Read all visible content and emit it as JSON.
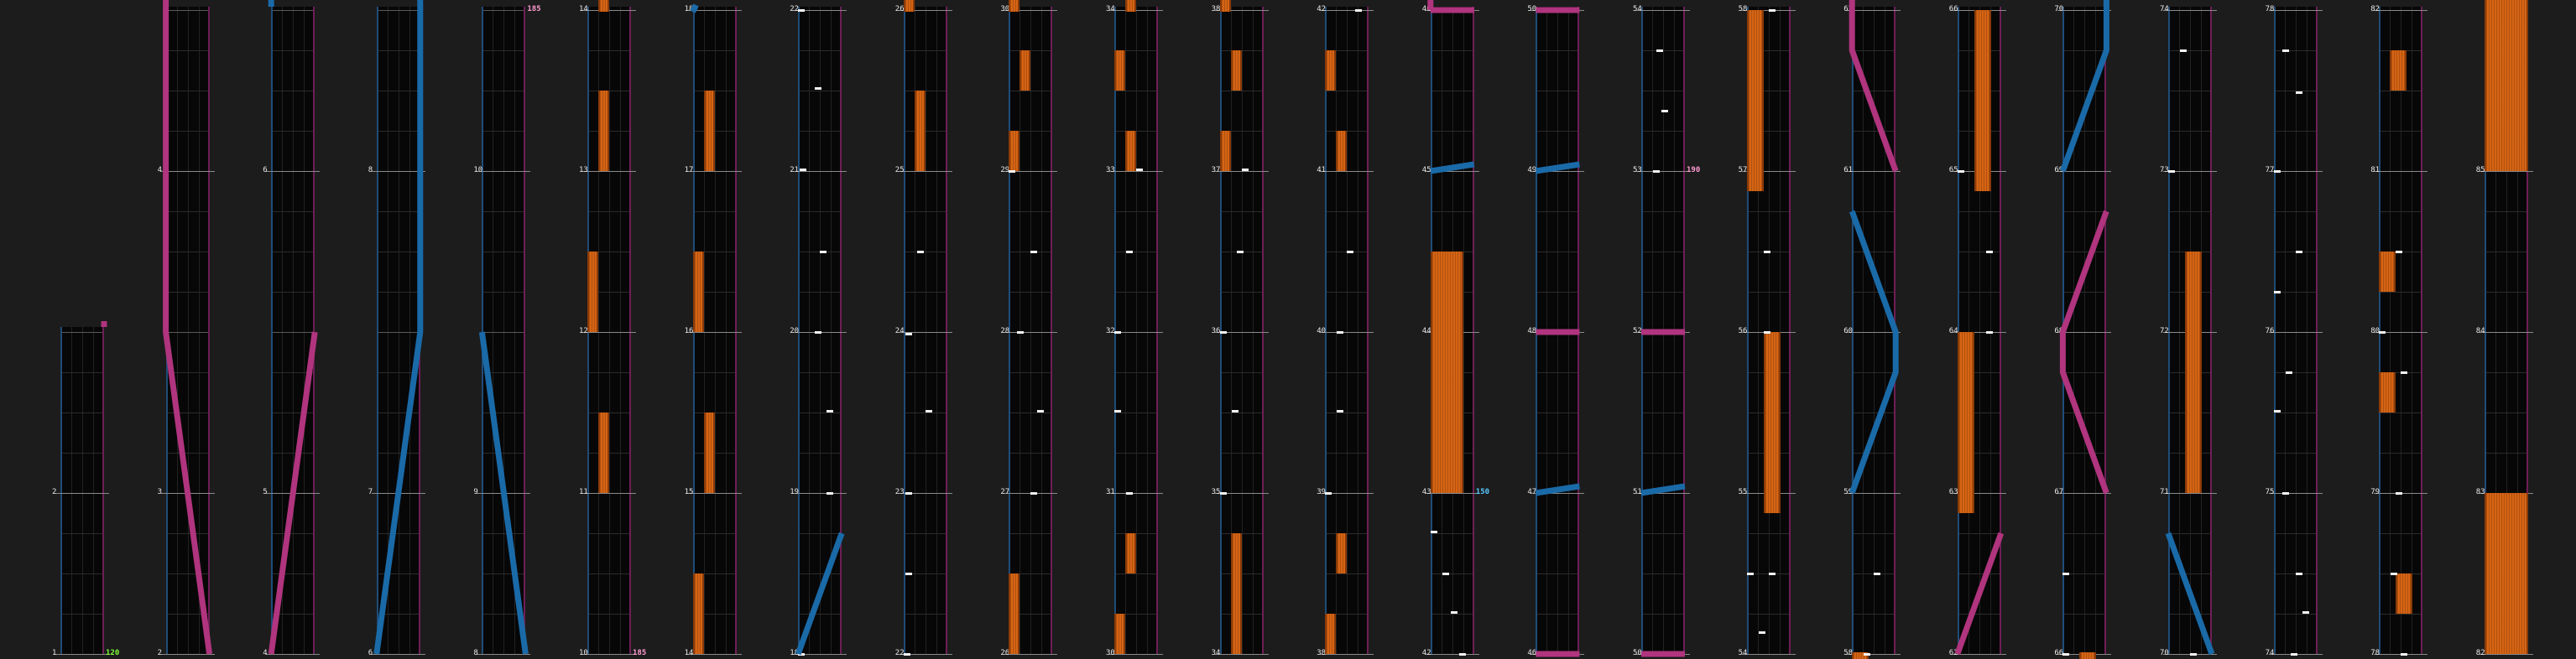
{
  "colors": {
    "background": "#1c1c1c",
    "lane": "#070707",
    "left_slide": "#1a6aa8",
    "right_slide": "#b0347e",
    "hold": "#d66414",
    "tap": "#f3f3f3",
    "bpm_green": "#7fff3a",
    "bpm_pink": "#ff9bd2",
    "bpm_blue": "#58c8ff"
  },
  "measures": [
    {
      "n": "1",
      "c": 0,
      "r": 0
    },
    {
      "n": "2",
      "c": 0,
      "r": 1
    },
    {
      "n": "2",
      "c": 1,
      "r": 0
    },
    {
      "n": "3",
      "c": 1,
      "r": 1
    },
    {
      "n": "4",
      "c": 1,
      "r": 3
    },
    {
      "n": "4",
      "c": 2,
      "r": 0
    },
    {
      "n": "5",
      "c": 2,
      "r": 1
    },
    {
      "n": "6",
      "c": 2,
      "r": 3
    },
    {
      "n": "6",
      "c": 3,
      "r": 0
    },
    {
      "n": "7",
      "c": 3,
      "r": 1
    },
    {
      "n": "8",
      "c": 3,
      "r": 3
    },
    {
      "n": "8",
      "c": 4,
      "r": 0
    },
    {
      "n": "9",
      "c": 4,
      "r": 1
    },
    {
      "n": "10",
      "c": 4,
      "r": 3
    },
    {
      "n": "10",
      "c": 5,
      "r": 0
    },
    {
      "n": "11",
      "c": 5,
      "r": 1
    },
    {
      "n": "12",
      "c": 5,
      "r": 2
    },
    {
      "n": "13",
      "c": 5,
      "r": 3
    },
    {
      "n": "14",
      "c": 5,
      "r": 4
    },
    {
      "n": "14",
      "c": 6,
      "r": 0
    },
    {
      "n": "15",
      "c": 6,
      "r": 1
    },
    {
      "n": "16",
      "c": 6,
      "r": 2
    },
    {
      "n": "17",
      "c": 6,
      "r": 3
    },
    {
      "n": "18",
      "c": 6,
      "r": 4
    },
    {
      "n": "18",
      "c": 7,
      "r": 0
    },
    {
      "n": "19",
      "c": 7,
      "r": 1
    },
    {
      "n": "20",
      "c": 7,
      "r": 2
    },
    {
      "n": "21",
      "c": 7,
      "r": 3
    },
    {
      "n": "22",
      "c": 7,
      "r": 4
    },
    {
      "n": "22",
      "c": 8,
      "r": 0
    },
    {
      "n": "23",
      "c": 8,
      "r": 1
    },
    {
      "n": "24",
      "c": 8,
      "r": 2
    },
    {
      "n": "25",
      "c": 8,
      "r": 3
    },
    {
      "n": "26",
      "c": 8,
      "r": 4
    },
    {
      "n": "26",
      "c": 9,
      "r": 0
    },
    {
      "n": "27",
      "c": 9,
      "r": 1
    },
    {
      "n": "28",
      "c": 9,
      "r": 2
    },
    {
      "n": "29",
      "c": 9,
      "r": 3
    },
    {
      "n": "30",
      "c": 9,
      "r": 4
    },
    {
      "n": "30",
      "c": 10,
      "r": 0
    },
    {
      "n": "31",
      "c": 10,
      "r": 1
    },
    {
      "n": "32",
      "c": 10,
      "r": 2
    },
    {
      "n": "33",
      "c": 10,
      "r": 3
    },
    {
      "n": "34",
      "c": 10,
      "r": 4
    },
    {
      "n": "34",
      "c": 11,
      "r": 0
    },
    {
      "n": "35",
      "c": 11,
      "r": 1
    },
    {
      "n": "36",
      "c": 11,
      "r": 2
    },
    {
      "n": "37",
      "c": 11,
      "r": 3
    },
    {
      "n": "38",
      "c": 11,
      "r": 4
    },
    {
      "n": "38",
      "c": 12,
      "r": 0
    },
    {
      "n": "39",
      "c": 12,
      "r": 1
    },
    {
      "n": "40",
      "c": 12,
      "r": 2
    },
    {
      "n": "41",
      "c": 12,
      "r": 3
    },
    {
      "n": "42",
      "c": 12,
      "r": 4
    },
    {
      "n": "42",
      "c": 13,
      "r": 0
    },
    {
      "n": "43",
      "c": 13,
      "r": 1
    },
    {
      "n": "44",
      "c": 13,
      "r": 2
    },
    {
      "n": "45",
      "c": 13,
      "r": 3
    },
    {
      "n": "46",
      "c": 13,
      "r": 4
    },
    {
      "n": "46",
      "c": 14,
      "r": 0
    },
    {
      "n": "47",
      "c": 14,
      "r": 1
    },
    {
      "n": "48",
      "c": 14,
      "r": 2
    },
    {
      "n": "49",
      "c": 14,
      "r": 3
    },
    {
      "n": "50",
      "c": 14,
      "r": 4
    },
    {
      "n": "50",
      "c": 15,
      "r": 0
    },
    {
      "n": "51",
      "c": 15,
      "r": 1
    },
    {
      "n": "52",
      "c": 15,
      "r": 2
    },
    {
      "n": "53",
      "c": 15,
      "r": 3
    },
    {
      "n": "54",
      "c": 15,
      "r": 4
    },
    {
      "n": "54",
      "c": 16,
      "r": 0
    },
    {
      "n": "55",
      "c": 16,
      "r": 1
    },
    {
      "n": "56",
      "c": 16,
      "r": 2
    },
    {
      "n": "57",
      "c": 16,
      "r": 3
    },
    {
      "n": "58",
      "c": 16,
      "r": 4
    },
    {
      "n": "58",
      "c": 17,
      "r": 0
    },
    {
      "n": "59",
      "c": 17,
      "r": 1
    },
    {
      "n": "60",
      "c": 17,
      "r": 2
    },
    {
      "n": "61",
      "c": 17,
      "r": 3
    },
    {
      "n": "62",
      "c": 17,
      "r": 4
    },
    {
      "n": "62",
      "c": 18,
      "r": 0
    },
    {
      "n": "63",
      "c": 18,
      "r": 1
    },
    {
      "n": "64",
      "c": 18,
      "r": 2
    },
    {
      "n": "65",
      "c": 18,
      "r": 3
    },
    {
      "n": "66",
      "c": 18,
      "r": 4
    },
    {
      "n": "66",
      "c": 19,
      "r": 0
    },
    {
      "n": "67",
      "c": 19,
      "r": 1
    },
    {
      "n": "68",
      "c": 19,
      "r": 2
    },
    {
      "n": "69",
      "c": 19,
      "r": 3
    },
    {
      "n": "70",
      "c": 19,
      "r": 4
    },
    {
      "n": "70",
      "c": 20,
      "r": 0
    },
    {
      "n": "71",
      "c": 20,
      "r": 1
    },
    {
      "n": "72",
      "c": 20,
      "r": 2
    },
    {
      "n": "73",
      "c": 20,
      "r": 3
    },
    {
      "n": "74",
      "c": 20,
      "r": 4
    },
    {
      "n": "74",
      "c": 21,
      "r": 0
    },
    {
      "n": "75",
      "c": 21,
      "r": 1
    },
    {
      "n": "76",
      "c": 21,
      "r": 2
    },
    {
      "n": "77",
      "c": 21,
      "r": 3
    },
    {
      "n": "78",
      "c": 21,
      "r": 4
    },
    {
      "n": "78",
      "c": 22,
      "r": 0
    },
    {
      "n": "79",
      "c": 22,
      "r": 1
    },
    {
      "n": "80",
      "c": 22,
      "r": 2
    },
    {
      "n": "81",
      "c": 22,
      "r": 3
    },
    {
      "n": "82",
      "c": 22,
      "r": 4
    },
    {
      "n": "82",
      "c": 23,
      "r": 0
    },
    {
      "n": "83",
      "c": 23,
      "r": 1
    },
    {
      "n": "84",
      "c": 23,
      "r": 2
    },
    {
      "n": "85",
      "c": 23,
      "r": 3
    }
  ],
  "bpm_marks": [
    {
      "text": "120",
      "c": 0,
      "r": 0,
      "color": "bpm_green"
    },
    {
      "text": "185",
      "c": 4,
      "r": 4,
      "color": "bpm_pink"
    },
    {
      "text": "185",
      "c": 5,
      "r": 0,
      "color": "bpm_pink"
    },
    {
      "text": "150",
      "c": 13,
      "r": 1,
      "color": "bpm_blue"
    },
    {
      "text": "190",
      "c": 15,
      "r": 3,
      "color": "bpm_pink"
    }
  ]
}
